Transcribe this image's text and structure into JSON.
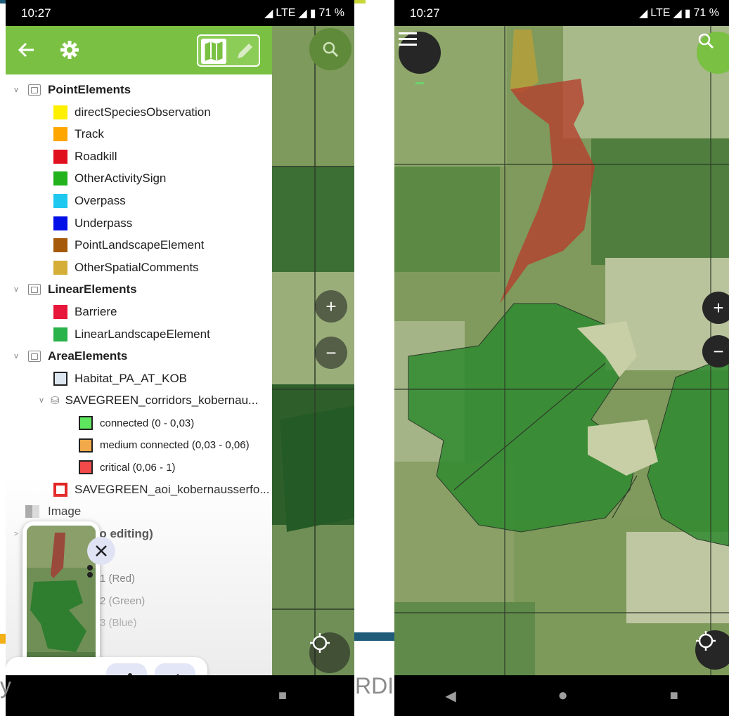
{
  "colors": {
    "brand_green": "#7ac043",
    "status_bg": "#000000"
  },
  "left_phone": {
    "status": {
      "time": "10:27",
      "network": "LTE",
      "battery": "71 %"
    },
    "toolbar": {
      "back_icon": "arrow-left-icon",
      "settings_icon": "gear-icon",
      "map_toggle_icon": "map-icon",
      "edit_icon": "pencil-icon"
    },
    "search_icon": "search-icon",
    "tree": {
      "groups": [
        {
          "label": "PointElements",
          "items": [
            {
              "label": "directSpeciesObservation",
              "color": "#ffef00"
            },
            {
              "label": "Track",
              "color": "#ffa600"
            },
            {
              "label": "Roadkill",
              "color": "#e0101e"
            },
            {
              "label": "OtherActivitySign",
              "color": "#21b21c"
            },
            {
              "label": "Overpass",
              "color": "#1fc8ef"
            },
            {
              "label": "Underpass",
              "color": "#0410e8"
            },
            {
              "label": "PointLandscapeElement",
              "color": "#a45a0a"
            },
            {
              "label": "OtherSpatialComments",
              "color": "#d4ae37"
            }
          ]
        },
        {
          "label": "LinearElements",
          "items": [
            {
              "label": "Barriere",
              "color": "#e8163a"
            },
            {
              "label": "LinearLandscapeElement",
              "color": "#2ab24b"
            }
          ]
        },
        {
          "label": "AreaElements",
          "items": [
            {
              "label": "Habitat_PA_AT_KOB",
              "color": "#dce6f0"
            }
          ]
        }
      ],
      "corridors": {
        "label": "SAVEGREEN_corridors_kobernau...",
        "classes": [
          {
            "label": "connected (0 - 0,03)",
            "color": "#5fe65f"
          },
          {
            "label": "medium connected (0,03 - 0,06)",
            "color": "#f2a94a"
          },
          {
            "label": "critical (0,06 - 1)",
            "color": "#f24a4a"
          }
        ]
      },
      "aoi": {
        "label": "SAVEGREEN_aoi_kobernausserfo...",
        "color": "#e21b1b"
      },
      "image": {
        "label": "Image"
      },
      "tables": {
        "label": "Tables (no editing)"
      },
      "bands": [
        "1 (Red)",
        "2 (Green)",
        "3 (Blue)"
      ]
    },
    "floating": {
      "close_icon": "close-icon",
      "share_icon": "share-icon",
      "edit_icon": "pencil-icon"
    },
    "map_controls": {
      "zoom_in": "+",
      "zoom_out": "−"
    },
    "background_text": {
      "left": "y",
      "right": "RDI"
    },
    "nav": {
      "back": "◀",
      "home": "●",
      "recents": "■"
    }
  },
  "right_phone": {
    "status": {
      "time": "10:27",
      "network": "LTE",
      "battery": "71 %"
    },
    "menu_icon": "menu-icon",
    "search_icon": "search-icon",
    "zoom_in": "+",
    "zoom_out": "−",
    "gps_icon": "crosshair-icon",
    "nav": {
      "back": "◀",
      "home": "●",
      "recents": "■"
    }
  }
}
